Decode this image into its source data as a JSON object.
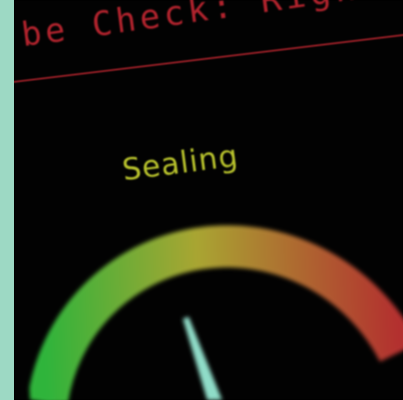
{
  "header": {
    "title": "be Check: Righ"
  },
  "gauge": {
    "label": "Sealing",
    "colors": {
      "low": "#2fb43b",
      "mid": "#a9a532",
      "high": "#b3302f",
      "needle": "#8fdcc8",
      "label": "#b7c12b",
      "header": "#b0222c"
    }
  }
}
